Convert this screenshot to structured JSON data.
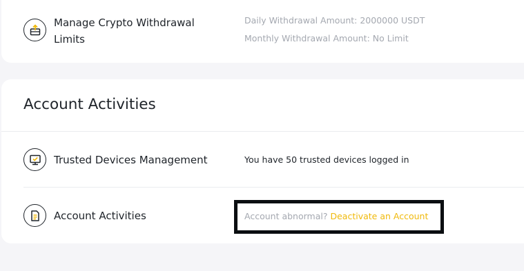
{
  "withdrawal": {
    "label_line1": "Manage Crypto Withdrawal",
    "label_line2": "Limits",
    "daily": "Daily Withdrawal Amount: 2000000 USDT",
    "monthly": "Monthly Withdrawal Amount: No Limit",
    "icon": "upload-tray-icon"
  },
  "activities": {
    "section_title": "Account Activities",
    "trusted_devices": {
      "label": "Trusted Devices Management",
      "value": "You have 50 trusted devices logged in",
      "icon": "monitor-check-icon"
    },
    "account_activities": {
      "label": "Account Activities",
      "abnormal_text": "Account abnormal?",
      "deactivate_link": "Deactivate an Account",
      "icon": "document-icon"
    }
  },
  "colors": {
    "accent": "#f0b90b",
    "text": "#1e2329",
    "muted": "#a4a8b0",
    "background": "#f5f5f8",
    "highlight_border": "#0b0e11"
  }
}
